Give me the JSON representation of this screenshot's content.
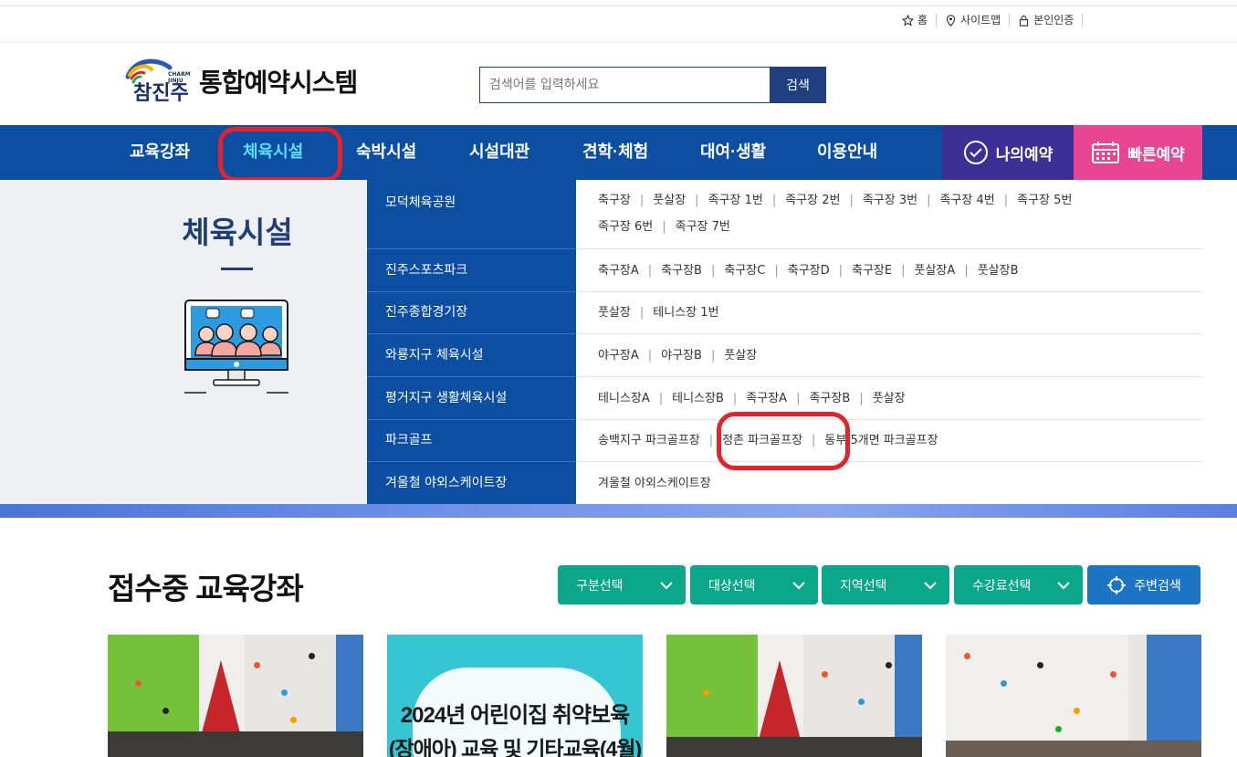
{
  "util_links": [
    {
      "icon": "star-icon",
      "label": "홈"
    },
    {
      "icon": "map-pin-icon",
      "label": "사이트맵"
    },
    {
      "icon": "lock-icon",
      "label": "본인인증"
    }
  ],
  "header": {
    "logo_text_small": "CHARM JINJU",
    "logo_text": "참진주",
    "title": "통합예약시스템",
    "search_placeholder": "검색어를 입력하세요",
    "search_button": "검색"
  },
  "nav": {
    "items": [
      "교육강좌",
      "체육시설",
      "숙박시설",
      "시설대관",
      "견학·체험",
      "대여·생활",
      "이용안내"
    ],
    "active": "체육시설",
    "my_reservation": "나의예약",
    "quick_reservation": "빠른예약"
  },
  "dropdown": {
    "title": "체육시설",
    "categories": [
      {
        "name": "모덕체육공원",
        "items": [
          "축구장",
          "풋살장",
          "족구장 1번",
          "족구장 2번",
          "족구장 3번",
          "족구장 4번",
          "족구장 5번",
          "족구장 6번",
          "족구장 7번"
        ]
      },
      {
        "name": "진주스포츠파크",
        "items": [
          "축구장A",
          "축구장B",
          "축구장C",
          "축구장D",
          "축구장E",
          "풋살장A",
          "풋살장B"
        ]
      },
      {
        "name": "진주종합경기장",
        "items": [
          "풋살장",
          "테니스장 1번"
        ]
      },
      {
        "name": "와룡지구 체육시설",
        "items": [
          "야구장A",
          "야구장B",
          "풋살장"
        ]
      },
      {
        "name": "평거지구 생활체육시설",
        "items": [
          "테니스장A",
          "테니스장B",
          "족구장A",
          "족구장B",
          "풋살장"
        ]
      },
      {
        "name": "파크골프",
        "items": [
          "송백지구 파크골프장",
          "정촌 파크골프장",
          "동부 5개면 파크골프장"
        ]
      },
      {
        "name": "겨울철 야외스케이트장",
        "items": [
          "겨울철 야외스케이트장"
        ]
      }
    ]
  },
  "section": {
    "title": "접수중 교육강좌",
    "filters": [
      "구분선택",
      "대상선택",
      "지역선택",
      "수강료선택"
    ],
    "nearby": "주변검색"
  },
  "cards": [
    {
      "type": "photo",
      "alt": "climbing"
    },
    {
      "type": "poster",
      "line1": "2024년 어린이집 취약보육",
      "line2": "(장애아) 교육 및 기타교육(4월)"
    },
    {
      "type": "photo",
      "alt": "climbing"
    },
    {
      "type": "photo",
      "alt": "climbing"
    }
  ],
  "colors": {
    "nav_bg": "#0b4ea2",
    "active_nav": "#5ee0ff",
    "my_res_bg": "#3c3096",
    "quick_bg": "#ea4592",
    "filter_bg": "#0aa78a",
    "nearby_bg": "#1b74c4",
    "highlight": "#e5212a"
  }
}
